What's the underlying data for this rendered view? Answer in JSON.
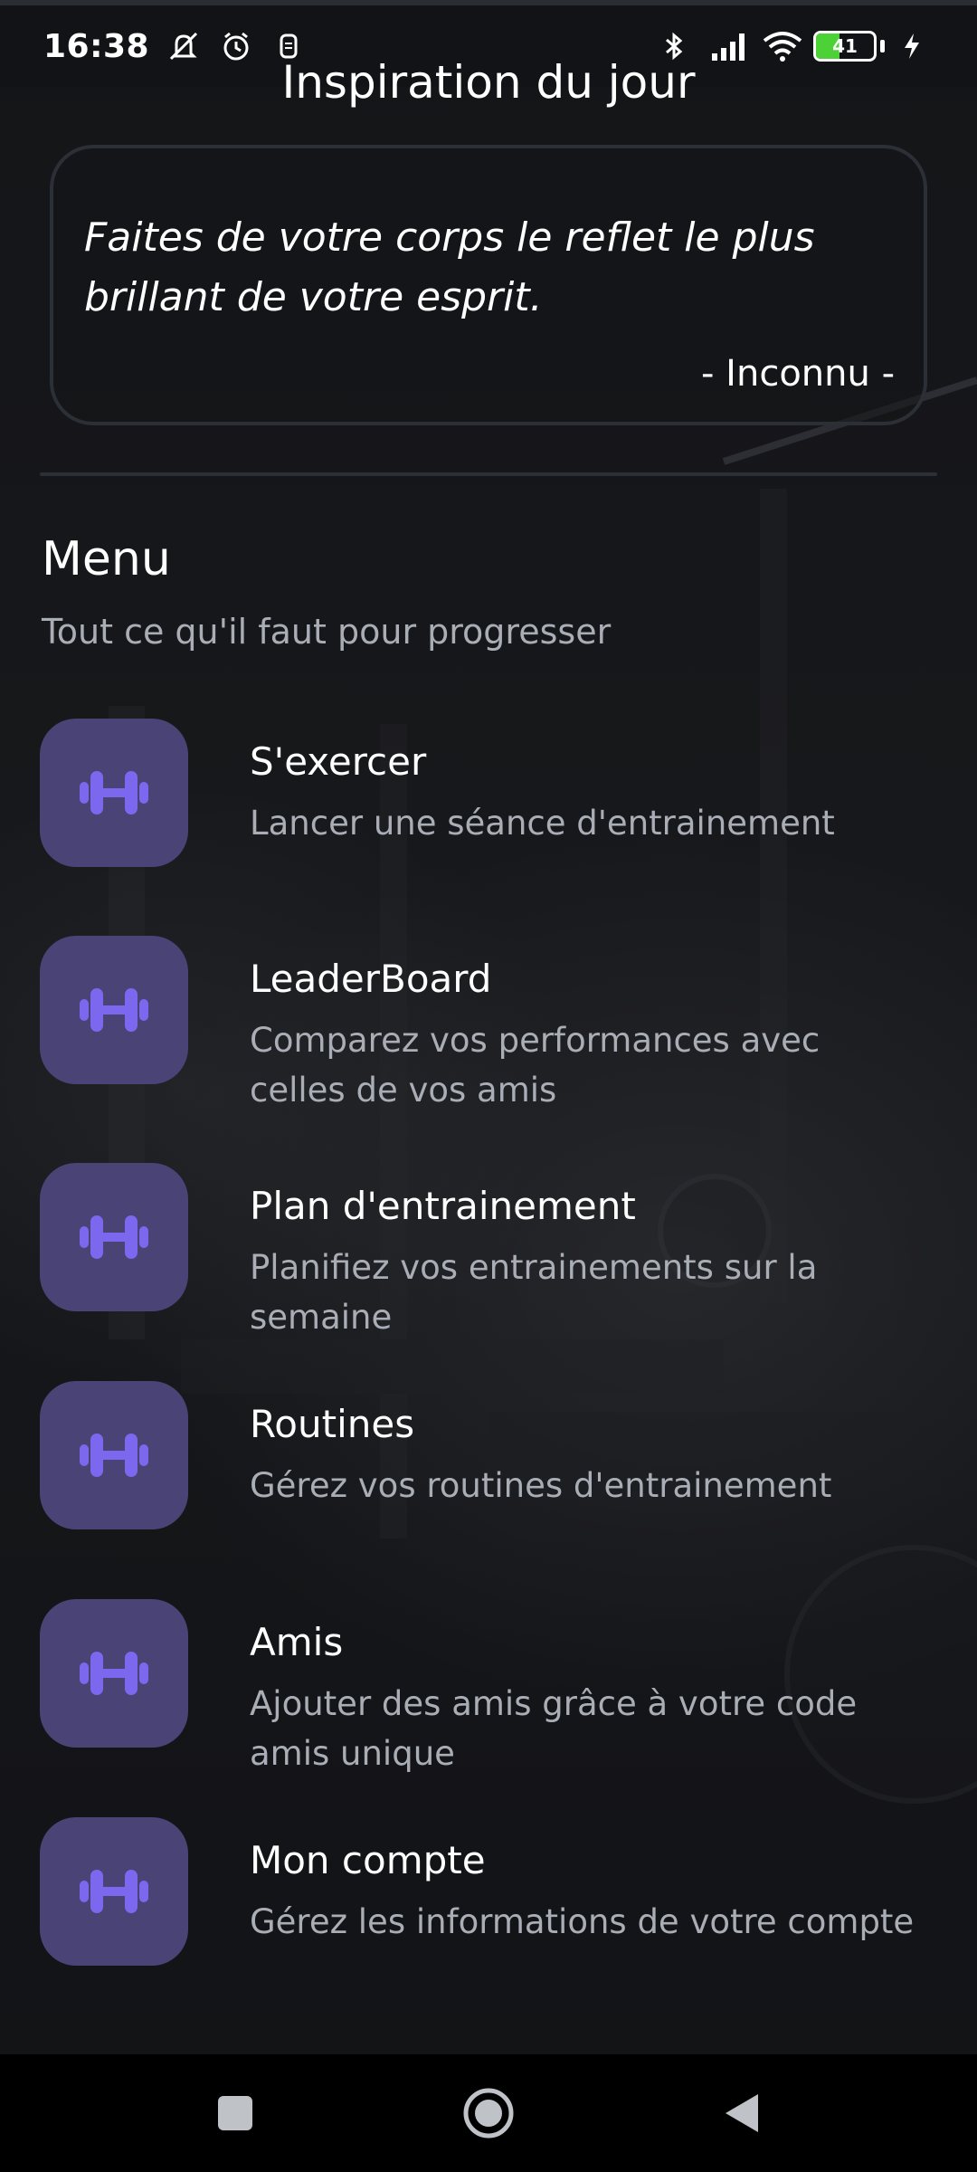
{
  "status_bar": {
    "time": "16:38",
    "battery_level": "41",
    "icons": [
      "muted-bell-icon",
      "alarm-icon",
      "screen-record-icon",
      "bluetooth-icon",
      "signal-icon",
      "wifi-icon",
      "battery-icon",
      "charging-icon"
    ]
  },
  "inspiration": {
    "title": "Inspiration du jour",
    "quote_line1": "Faites de votre corps le reflet le plus",
    "quote_line2": "brillant de votre esprit.",
    "author": "- Inconnu -"
  },
  "menu": {
    "title": "Menu",
    "subtitle": "Tout ce qu'il faut pour progresser",
    "items": [
      {
        "title": "S'exercer",
        "desc_line1": "Lancer une séance d'entrainement",
        "desc_line2": "",
        "icon": "dumbbell-icon"
      },
      {
        "title": "LeaderBoard",
        "desc_line1": "Comparez vos performances avec",
        "desc_line2": "celles de vos amis",
        "icon": "dumbbell-icon"
      },
      {
        "title": "Plan d'entrainement",
        "desc_line1": "Planifiez vos entrainements sur la",
        "desc_line2": "semaine",
        "icon": "dumbbell-icon"
      },
      {
        "title": "Routines",
        "desc_line1": "Gérez vos routines d'entrainement",
        "desc_line2": "",
        "icon": "dumbbell-icon"
      },
      {
        "title": "Amis",
        "desc_line1": "Ajouter des amis grâce à votre code",
        "desc_line2": "amis unique",
        "icon": "dumbbell-icon"
      },
      {
        "title": "Mon compte",
        "desc_line1": "Gérez les informations de votre compte",
        "desc_line2": "",
        "icon": "dumbbell-icon"
      }
    ]
  },
  "nav_bar": {
    "buttons": [
      "recents-square-icon",
      "home-circle-icon",
      "back-triangle-icon"
    ]
  },
  "colors": {
    "accent": "#7b68ee",
    "icon_box": "#4a4376",
    "text_secondary": "#a9adb5"
  }
}
